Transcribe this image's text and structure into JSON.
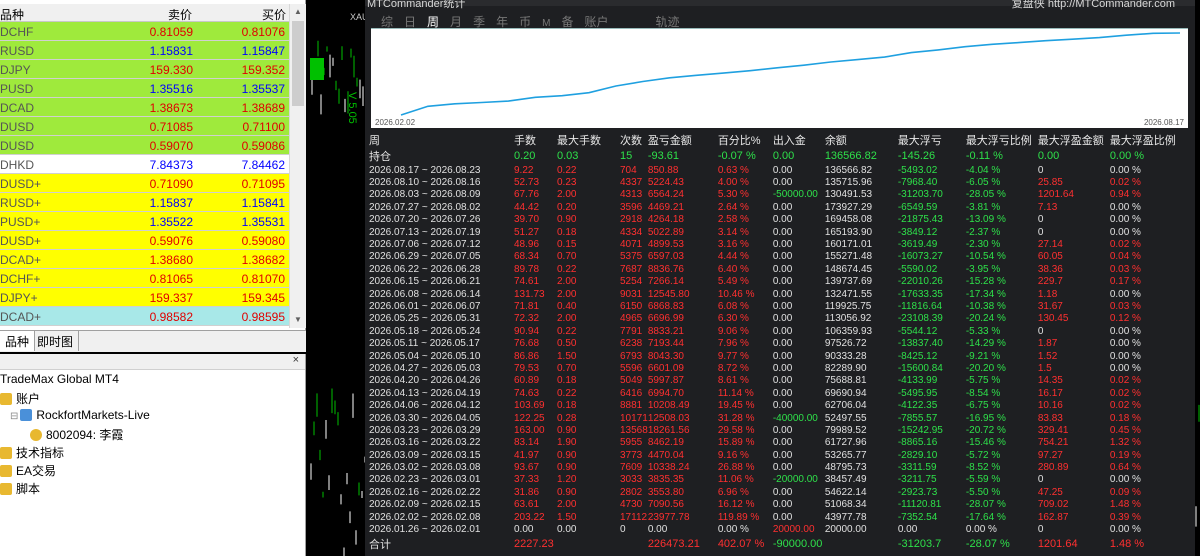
{
  "market_watch": {
    "headers": {
      "symbol": "品种",
      "bid": "卖价",
      "ask": "买价"
    },
    "rows": [
      {
        "symbol": "DCHF",
        "bid": "0.81059",
        "ask": "0.81076",
        "bg": "green",
        "color": "red"
      },
      {
        "symbol": "RUSD",
        "bid": "1.15831",
        "ask": "1.15847",
        "bg": "green",
        "color": "blue"
      },
      {
        "symbol": "DJPY",
        "bid": "159.330",
        "ask": "159.352",
        "bg": "green",
        "color": "red"
      },
      {
        "symbol": "PUSD",
        "bid": "1.35516",
        "ask": "1.35537",
        "bg": "green",
        "color": "blue"
      },
      {
        "symbol": "DCAD",
        "bid": "1.38673",
        "ask": "1.38689",
        "bg": "green",
        "color": "red"
      },
      {
        "symbol": "DUSD",
        "bid": "0.71085",
        "ask": "0.71100",
        "bg": "green",
        "color": "red"
      },
      {
        "symbol": "DUSD",
        "bid": "0.59070",
        "ask": "0.59086",
        "bg": "green",
        "color": "red"
      },
      {
        "symbol": "DHKD",
        "bid": "7.84373",
        "ask": "7.84462",
        "bg": "white",
        "color": "blue"
      },
      {
        "symbol": "DUSD+",
        "bid": "0.71090",
        "ask": "0.71095",
        "bg": "yellow",
        "color": "red"
      },
      {
        "symbol": "RUSD+",
        "bid": "1.15837",
        "ask": "1.15841",
        "bg": "yellow",
        "color": "blue"
      },
      {
        "symbol": "PUSD+",
        "bid": "1.35522",
        "ask": "1.35531",
        "bg": "yellow",
        "color": "blue"
      },
      {
        "symbol": "DUSD+",
        "bid": "0.59076",
        "ask": "0.59080",
        "bg": "yellow",
        "color": "red"
      },
      {
        "symbol": "DCAD+",
        "bid": "1.38680",
        "ask": "1.38682",
        "bg": "yellow",
        "color": "red"
      },
      {
        "symbol": "DCHF+",
        "bid": "0.81065",
        "ask": "0.81070",
        "bg": "yellow",
        "color": "red"
      },
      {
        "symbol": "DJPY+",
        "bid": "159.337",
        "ask": "159.345",
        "bg": "yellow",
        "color": "red"
      },
      {
        "symbol": "DCAD+",
        "bid": "0.98582",
        "ask": "0.98595",
        "bg": "cyan",
        "color": "red"
      }
    ],
    "tabs": [
      "品种",
      "即时图"
    ]
  },
  "navigator": {
    "title": "×",
    "items": [
      {
        "label": "TradeMax Global MT4",
        "icon": "platform-icon"
      },
      {
        "label": "账户",
        "icon": "accounts-icon"
      },
      {
        "label": "RockfortMarkets-Live",
        "icon": "server-icon"
      },
      {
        "label": "8002094: 李霞",
        "icon": "account-icon"
      },
      {
        "label": "技术指标",
        "icon": "indicators-icon"
      },
      {
        "label": "EA交易",
        "icon": "expert-advisors-icon"
      },
      {
        "label": "脚本",
        "icon": "scripts-icon"
      }
    ]
  },
  "chart": {
    "symbol_label": "XAUU",
    "vertical_label": "V 5.05"
  },
  "stats": {
    "title": "MTCommander统计",
    "link": "复盘侠 http://MTCommander.com",
    "tabs": [
      "综",
      "日",
      "周",
      "月",
      "季",
      "年",
      "币",
      "M",
      "备",
      "账户",
      "轨迹"
    ],
    "active_tab": "周",
    "curve_start": "2026.02.02",
    "curve_end": "2026.08.17",
    "columns": [
      "周",
      "手数",
      "最大手数",
      "次数",
      "盈亏金额",
      "百分比%",
      "出入金",
      "余额",
      "最大浮亏",
      "最大浮亏比例",
      "最大浮盈金额",
      "最大浮盈比例"
    ],
    "hold_row": [
      "持仓",
      "0.20",
      "0.03",
      "15",
      "-93.61",
      "-0.07 %",
      "0.00",
      "136566.82",
      "-145.26",
      "-0.11 %",
      "0.00",
      "0.00 %"
    ],
    "rows": [
      [
        "2026.08.17 ~ 2026.08.23",
        "9.22",
        "0.22",
        "704",
        "850.88",
        "0.63 %",
        "0.00",
        "136566.82",
        "-5493.02",
        "-4.04 %",
        "0",
        "0.00 %"
      ],
      [
        "2026.08.10 ~ 2026.08.16",
        "52.73",
        "0.23",
        "4337",
        "5224.43",
        "4.00 %",
        "0.00",
        "135715.96",
        "-7968.40",
        "-6.05 %",
        "25.85",
        "0.02 %"
      ],
      [
        "2026.08.03 ~ 2026.08.09",
        "67.76",
        "2.00",
        "4313",
        "6564.24",
        "5.30 %",
        "-50000.00",
        "130491.53",
        "-31203.70",
        "-28.05 %",
        "1201.64",
        "0.94 %"
      ],
      [
        "2026.07.27 ~ 2026.08.02",
        "44.42",
        "0.20",
        "3596",
        "4469.21",
        "2.64 %",
        "0.00",
        "173927.29",
        "-6549.59",
        "-3.81 %",
        "7.13",
        "0.00 %"
      ],
      [
        "2026.07.20 ~ 2026.07.26",
        "39.70",
        "0.90",
        "2918",
        "4264.18",
        "2.58 %",
        "0.00",
        "169458.08",
        "-21875.43",
        "-13.09 %",
        "0",
        "0.00 %"
      ],
      [
        "2026.07.13 ~ 2026.07.19",
        "51.27",
        "0.18",
        "4334",
        "5022.89",
        "3.14 %",
        "0.00",
        "165193.90",
        "-3849.12",
        "-2.37 %",
        "0",
        "0.00 %"
      ],
      [
        "2026.07.06 ~ 2026.07.12",
        "48.96",
        "0.15",
        "4071",
        "4899.53",
        "3.16 %",
        "0.00",
        "160171.01",
        "-3619.49",
        "-2.30 %",
        "27.14",
        "0.02 %"
      ],
      [
        "2026.06.29 ~ 2026.07.05",
        "68.34",
        "0.70",
        "5375",
        "6597.03",
        "4.44 %",
        "0.00",
        "155271.48",
        "-16073.27",
        "-10.54 %",
        "60.05",
        "0.04 %"
      ],
      [
        "2026.06.22 ~ 2026.06.28",
        "89.78",
        "0.22",
        "7687",
        "8836.76",
        "6.40 %",
        "0.00",
        "148674.45",
        "-5590.02",
        "-3.95 %",
        "38.36",
        "0.03 %"
      ],
      [
        "2026.06.15 ~ 2026.06.21",
        "74.61",
        "2.00",
        "5254",
        "7266.14",
        "5.49 %",
        "0.00",
        "139737.69",
        "-22010.26",
        "-15.28 %",
        "229.7",
        "0.17 %"
      ],
      [
        "2026.06.08 ~ 2026.06.14",
        "131.73",
        "2.00",
        "9031",
        "12545.80",
        "10.46 %",
        "0.00",
        "132471.55",
        "-17633.35",
        "-17.34 %",
        "1.18",
        "0.00 %"
      ],
      [
        "2026.06.01 ~ 2026.06.07",
        "71.81",
        "0.40",
        "6150",
        "6868.83",
        "6.08 %",
        "0.00",
        "119925.75",
        "-11816.64",
        "-10.38 %",
        "31.67",
        "0.03 %"
      ],
      [
        "2026.05.25 ~ 2026.05.31",
        "72.32",
        "2.00",
        "4965",
        "6696.99",
        "6.30 %",
        "0.00",
        "113056.92",
        "-23108.39",
        "-20.24 %",
        "130.45",
        "0.12 %"
      ],
      [
        "2026.05.18 ~ 2026.05.24",
        "90.94",
        "0.22",
        "7791",
        "8833.21",
        "9.06 %",
        "0.00",
        "106359.93",
        "-5544.12",
        "-5.33 %",
        "0",
        "0.00 %"
      ],
      [
        "2026.05.11 ~ 2026.05.17",
        "76.68",
        "0.50",
        "6238",
        "7193.44",
        "7.96 %",
        "0.00",
        "97526.72",
        "-13837.40",
        "-14.29 %",
        "1.87",
        "0.00 %"
      ],
      [
        "2026.05.04 ~ 2026.05.10",
        "86.86",
        "1.50",
        "6793",
        "8043.30",
        "9.77 %",
        "0.00",
        "90333.28",
        "-8425.12",
        "-9.21 %",
        "1.52",
        "0.00 %"
      ],
      [
        "2026.04.27 ~ 2026.05.03",
        "79.53",
        "0.70",
        "5596",
        "6601.09",
        "8.72 %",
        "0.00",
        "82289.90",
        "-15600.84",
        "-20.20 %",
        "1.5",
        "0.00 %"
      ],
      [
        "2026.04.20 ~ 2026.04.26",
        "60.89",
        "0.18",
        "5049",
        "5997.87",
        "8.61 %",
        "0.00",
        "75688.81",
        "-4133.99",
        "-5.75 %",
        "14.35",
        "0.02 %"
      ],
      [
        "2026.04.13 ~ 2026.04.19",
        "74.63",
        "0.22",
        "6416",
        "6994.70",
        "11.14 %",
        "0.00",
        "69690.94",
        "-5495.95",
        "-8.54 %",
        "16.17",
        "0.02 %"
      ],
      [
        "2026.04.06 ~ 2026.04.12",
        "103.69",
        "0.18",
        "8881",
        "10208.49",
        "19.45 %",
        "0.00",
        "62706.04",
        "-4122.35",
        "-6.75 %",
        "10.16",
        "0.02 %"
      ],
      [
        "2026.03.30 ~ 2026.04.05",
        "122.25",
        "0.28",
        "10171",
        "12508.03",
        "31.28 %",
        "-40000.00",
        "52497.55",
        "-7855.57",
        "-16.95 %",
        "83.83",
        "0.18 %"
      ],
      [
        "2026.03.23 ~ 2026.03.29",
        "163.00",
        "0.90",
        "13568",
        "18261.56",
        "29.58 %",
        "0.00",
        "79989.52",
        "-15242.95",
        "-20.72 %",
        "329.41",
        "0.45 %"
      ],
      [
        "2026.03.16 ~ 2026.03.22",
        "83.14",
        "1.90",
        "5955",
        "8462.19",
        "15.89 %",
        "0.00",
        "61727.96",
        "-8865.16",
        "-15.46 %",
        "754.21",
        "1.32 %"
      ],
      [
        "2026.03.09 ~ 2026.03.15",
        "41.97",
        "0.90",
        "3773",
        "4470.04",
        "9.16 %",
        "0.00",
        "53265.77",
        "-2829.10",
        "-5.72 %",
        "97.27",
        "0.19 %"
      ],
      [
        "2026.03.02 ~ 2026.03.08",
        "93.67",
        "0.90",
        "7609",
        "10338.24",
        "26.88 %",
        "0.00",
        "48795.73",
        "-3311.59",
        "-8.52 %",
        "280.89",
        "0.64 %"
      ],
      [
        "2026.02.23 ~ 2026.03.01",
        "37.33",
        "1.20",
        "3033",
        "3835.35",
        "11.06 %",
        "-20000.00",
        "38457.49",
        "-3211.75",
        "-5.59 %",
        "0",
        "0.00 %"
      ],
      [
        "2026.02.16 ~ 2026.02.22",
        "31.86",
        "0.90",
        "2802",
        "3553.80",
        "6.96 %",
        "0.00",
        "54622.14",
        "-2923.73",
        "-5.50 %",
        "47.25",
        "0.09 %"
      ],
      [
        "2026.02.09 ~ 2026.02.15",
        "63.61",
        "2.00",
        "4730",
        "7090.56",
        "16.12 %",
        "0.00",
        "51068.34",
        "-11120.81",
        "-28.07 %",
        "709.02",
        "1.48 %"
      ],
      [
        "2026.02.02 ~ 2026.02.08",
        "203.22",
        "1.50",
        "17112",
        "23977.78",
        "119.89 %",
        "0.00",
        "43977.78",
        "-7352.54",
        "-17.64 %",
        "162.87",
        "0.39 %"
      ],
      [
        "2026.01.26 ~ 2026.02.01",
        "0.00",
        "0.00",
        "0",
        "0.00",
        "0.00 %",
        "20000.00",
        "20000.00",
        "0.00",
        "0.00 %",
        "0",
        "0.00 %"
      ]
    ],
    "total_row": [
      "合计",
      "2227.23",
      "",
      "",
      "226473.21",
      "402.07 %",
      "-90000.00",
      "",
      "-31203.7",
      "-28.07 %",
      "1201.64",
      "1.48 %"
    ]
  },
  "equity_curve": [
    20000,
    43977.78,
    51068.34,
    54622.14,
    58457.49,
    68795.73,
    73265.77,
    81727.96,
    99989.52,
    112497.55,
    122706.04,
    129690.94,
    135688.81,
    142289.9,
    150333.28,
    157526.72,
    166359.93,
    173056.92,
    179925.75,
    192471.55,
    199737.69,
    208674.45,
    215271.48,
    220171.01,
    225193.9,
    229458.08,
    233927.29,
    240491.53,
    245715.96,
    246566.82
  ]
}
